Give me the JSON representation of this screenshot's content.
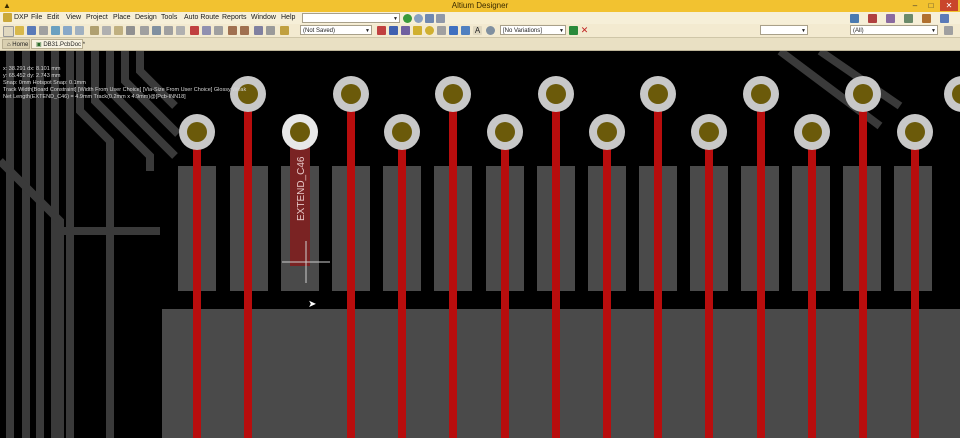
{
  "window": {
    "title": "Altium Designer",
    "icon": "altium-icon",
    "min": "–",
    "max": "□",
    "close": "✕"
  },
  "menu": {
    "items": [
      "DXP",
      "File",
      "Edit",
      "View",
      "Project",
      "Place",
      "Design",
      "Tools",
      "Auto Route",
      "Reports",
      "Window",
      "Help"
    ]
  },
  "toolbar": {
    "selection_filter": "(Not Saved)",
    "variants": "[No Variations]",
    "layer_set": "(All)"
  },
  "tabs": [
    {
      "label": "Home",
      "icon": "home-icon"
    },
    {
      "label": "DB31.PcbDoc *",
      "icon": "pcb-doc-icon"
    }
  ],
  "hud": {
    "x_line": "x: 38.291   dx: 8.101 mm",
    "y_line": "y: 65.452   dy: 2.743 mm",
    "snap_line": "Snap: 0mm Hotspot Snap: 0.1mm",
    "track_line": "Track Width[Board Constraint] [Width From User Choice] [Via-Size From User Choice] Glossy Weak",
    "net_line": "Net Length(EXTEND_C46) = 4.9mm  Track(0.2mm x 4.9mm)@[Pcb-INN18]"
  },
  "pcb": {
    "net_label": "EXTEND_C46",
    "colors": {
      "background": "#000000",
      "pad_ring": "#c8c8c8",
      "pad_hole": "#6b5a0a",
      "track_red": "#b80d0d",
      "track_gray": "#3a3a3a",
      "pad_rect": "#4a4a4a",
      "highlight_track": "#7a2323"
    }
  }
}
